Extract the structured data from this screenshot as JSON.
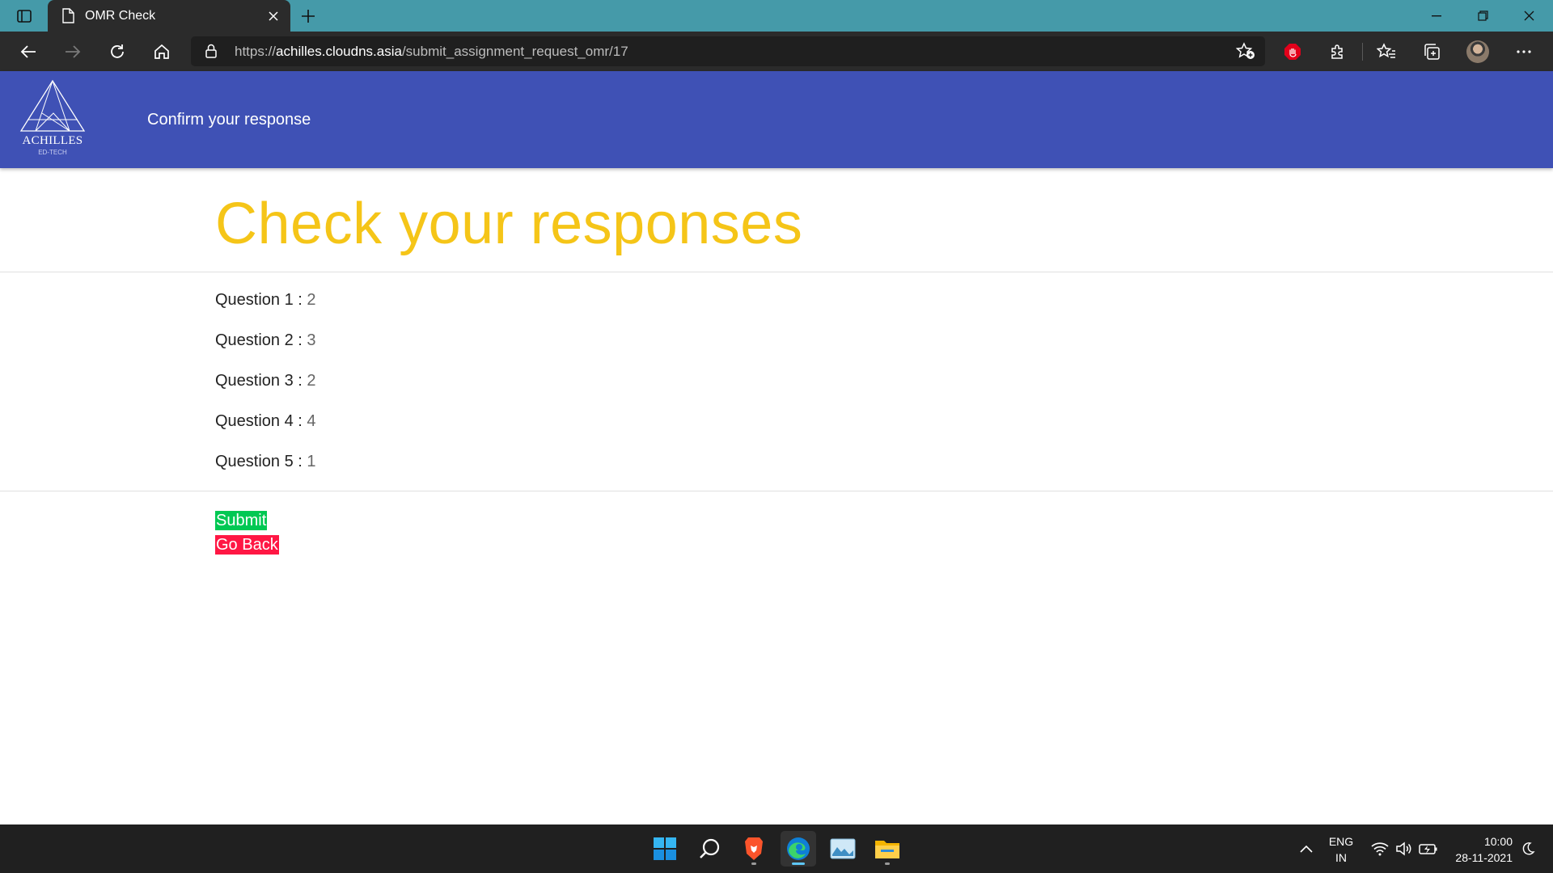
{
  "browser": {
    "tab_title": "OMR Check",
    "url_scheme": "https://",
    "url_host": "achilles.cloudns.asia",
    "url_path": "/submit_assignment_request_omr/17"
  },
  "header": {
    "logo_text": "ACHILLES",
    "logo_subtext": "ED-TECH",
    "title": "Confirm your response"
  },
  "main": {
    "heading": "Check your responses",
    "questions": [
      {
        "label": "Question 1 :",
        "answer": "2"
      },
      {
        "label": "Question 2 :",
        "answer": "3"
      },
      {
        "label": "Question 3 :",
        "answer": "2"
      },
      {
        "label": "Question 4 :",
        "answer": "4"
      },
      {
        "label": "Question 5 :",
        "answer": "1"
      }
    ],
    "submit_label": "Submit",
    "back_label": "Go Back"
  },
  "colors": {
    "header_bg": "#3f51b5",
    "heading": "#f5c518",
    "submit": "#00c853",
    "back": "#ff1744"
  },
  "taskbar": {
    "apps": [
      "start-icon",
      "search-icon",
      "brave-browser-icon",
      "edge-browser-icon",
      "photos-icon",
      "file-explorer-icon"
    ],
    "lang_top": "ENG",
    "lang_bottom": "IN",
    "time": "10:00",
    "date": "28-11-2021"
  }
}
